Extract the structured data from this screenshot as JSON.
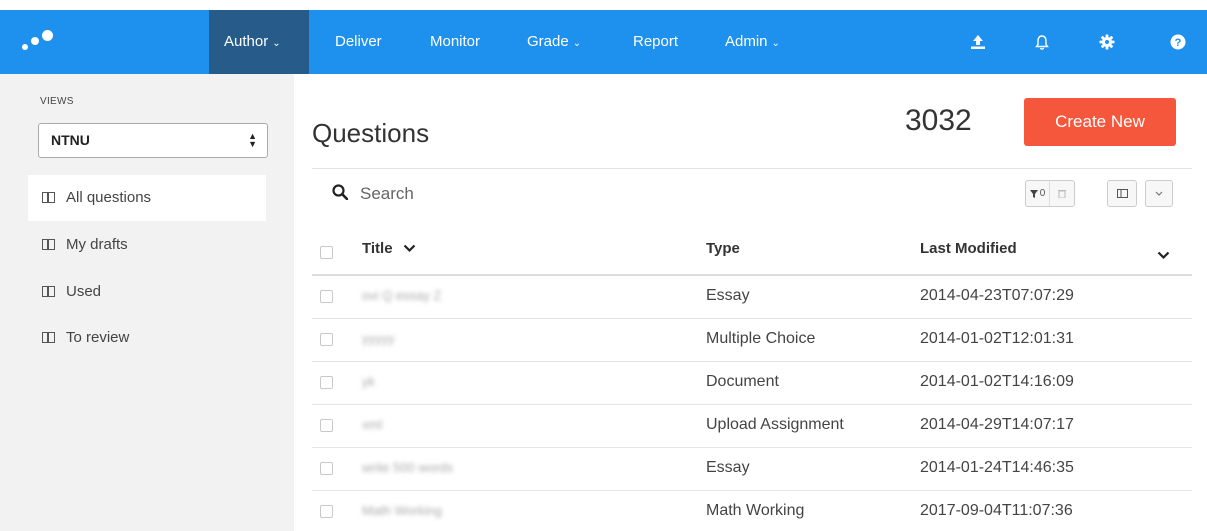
{
  "nav": {
    "items": [
      {
        "label": "Author",
        "caret": "⌄",
        "active": true
      },
      {
        "label": "Deliver",
        "caret": "",
        "active": false
      },
      {
        "label": "Monitor",
        "caret": "",
        "active": false
      },
      {
        "label": "Grade",
        "caret": "⌄",
        "active": false
      },
      {
        "label": "Report",
        "caret": "",
        "active": false
      },
      {
        "label": "Admin",
        "caret": "⌄",
        "active": false
      }
    ],
    "icons": [
      "upload-icon",
      "bell-icon",
      "gear-icon",
      "help-icon"
    ],
    "color": "#1e90ee",
    "active_color": "#275c8a"
  },
  "sidebar": {
    "views_label": "VIEWS",
    "selected_view": "NTNU",
    "items": [
      {
        "label": "All questions",
        "active": true
      },
      {
        "label": "My drafts",
        "active": false
      },
      {
        "label": "Used",
        "active": false
      },
      {
        "label": "To review",
        "active": false
      }
    ]
  },
  "main": {
    "title": "Questions",
    "count": "3032",
    "create_label": "Create New",
    "create_color": "#f4573c",
    "search_placeholder": "Search",
    "filter_count": "0"
  },
  "table": {
    "columns": [
      "Title",
      "Type",
      "Last Modified"
    ],
    "rows": [
      {
        "title": "ovi Q essay Z",
        "type": "Essay",
        "modified": "2014-04-23T07:07:29"
      },
      {
        "title": "yyyyy",
        "type": "Multiple Choice",
        "modified": "2014-01-02T12:01:31"
      },
      {
        "title": "yk",
        "type": "Document",
        "modified": "2014-01-02T14:16:09"
      },
      {
        "title": "xml",
        "type": "Upload Assignment",
        "modified": "2014-04-29T14:07:17"
      },
      {
        "title": "write 500 words",
        "type": "Essay",
        "modified": "2014-01-24T14:46:35"
      },
      {
        "title": "Math Working",
        "type": "Math Working",
        "modified": "2017-09-04T11:07:36"
      }
    ]
  }
}
